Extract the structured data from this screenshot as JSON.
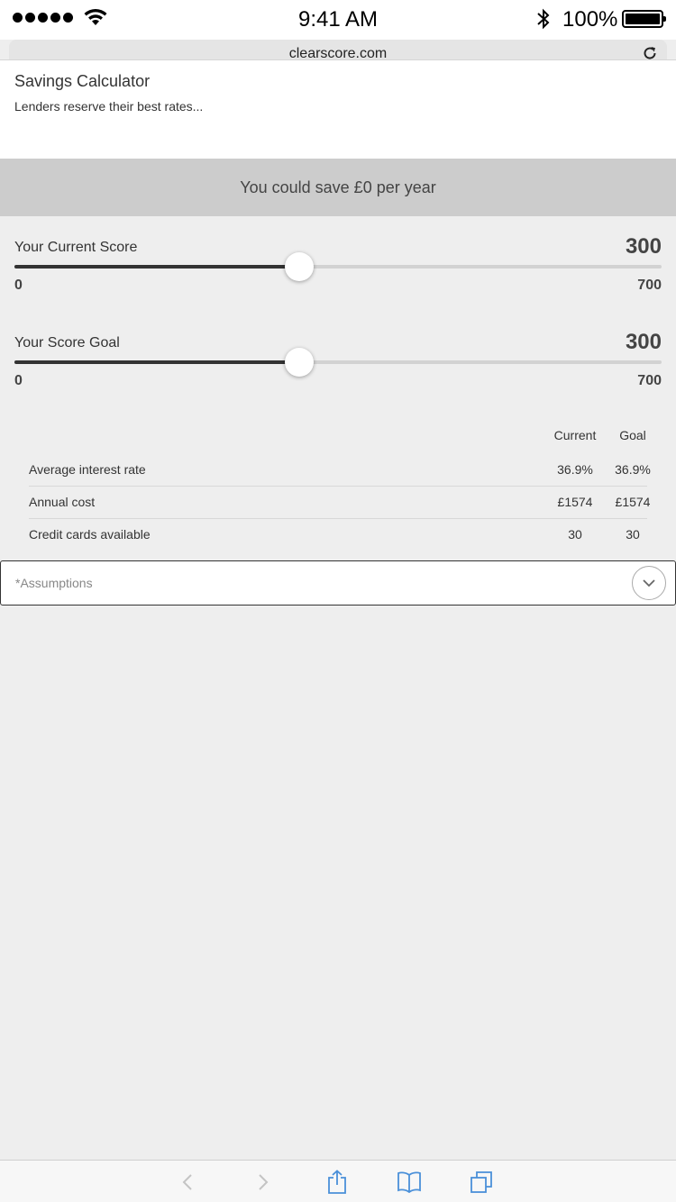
{
  "status_bar": {
    "time": "9:41 AM",
    "battery": "100%"
  },
  "browser": {
    "url": "clearscore.com"
  },
  "header": {
    "title": "Savings Calculator",
    "subtitle": "Lenders reserve their best rates..."
  },
  "banner": {
    "text": "You could save £0 per year"
  },
  "sliders": {
    "current": {
      "label": "Your Current Score",
      "value": "300",
      "min": "0",
      "max": "700",
      "position": 0.44
    },
    "goal": {
      "label": "Your Score Goal",
      "value": "300",
      "min": "0",
      "max": "700",
      "position": 0.44
    }
  },
  "table": {
    "columns": [
      "Current",
      "Goal"
    ],
    "rows": [
      {
        "label": "Average interest rate",
        "current": "36.9%",
        "goal": "36.9%"
      },
      {
        "label": "Annual cost",
        "current": "£1574",
        "goal": "£1574"
      },
      {
        "label": "Credit cards available",
        "current": "30",
        "goal": "30"
      }
    ]
  },
  "assumptions": {
    "label": "*Assumptions"
  },
  "colors": {
    "banner_bg": "#cccccc",
    "page_bg": "#eeeeee",
    "ios_blue": "#4a90d9",
    "track_fill": "#333333"
  },
  "icons": {
    "toolbar": [
      "back-icon",
      "forward-icon",
      "share-icon",
      "bookmarks-icon",
      "tabs-icon"
    ]
  }
}
